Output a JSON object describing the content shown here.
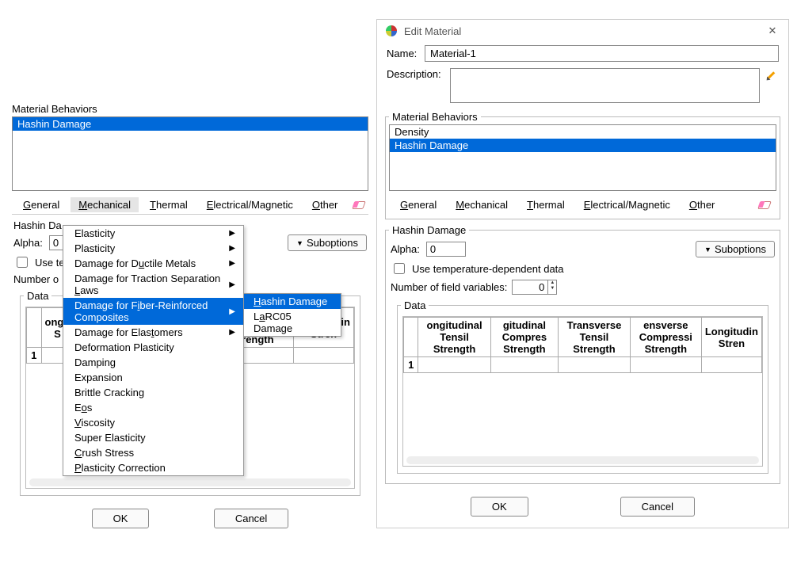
{
  "left": {
    "behaviors_label": "Material Behaviors",
    "behaviors": [
      "Hashin Damage"
    ],
    "selected_behavior": 0,
    "menubar": [
      "General",
      "Mechanical",
      "Thermal",
      "Electrical/Magnetic",
      "Other"
    ],
    "menu_underlines": [
      "G",
      "M",
      "T",
      "E",
      "O"
    ],
    "open_menu": 1,
    "dropdown": [
      {
        "label": "Elasticity",
        "has_sub": true
      },
      {
        "label": "Plasticity",
        "has_sub": true
      },
      {
        "label": "Damage for Ductile Metals",
        "ul": "D",
        "has_sub": true
      },
      {
        "label": "Damage for Traction Separation Laws",
        "ul": "L",
        "has_sub": true
      },
      {
        "label": "Damage for Fiber-Reinforced Composites",
        "ul": "i",
        "has_sub": true,
        "hover": true
      },
      {
        "label": "Damage for Elastomers",
        "ul": "t",
        "has_sub": true
      },
      {
        "label": "Deformation Plasticity"
      },
      {
        "label": "Damping"
      },
      {
        "label": "Expansion"
      },
      {
        "label": "Brittle Cracking"
      },
      {
        "label": "Eos",
        "ul": "o"
      },
      {
        "label": "Viscosity",
        "ul": "V"
      },
      {
        "label": "Super Elasticity"
      },
      {
        "label": "Crush Stress",
        "ul": "C"
      },
      {
        "label": "Plasticity Correction",
        "ul": "P"
      }
    ],
    "submenu": [
      {
        "label": "Hashin Damage",
        "ul": "H",
        "hover": true
      },
      {
        "label": "LaRC05 Damage",
        "ul": "a"
      }
    ],
    "hashin_label": "Hashin Da",
    "alpha_label": "Alpha:",
    "alpha_value": "0",
    "suboptions_label": "Suboptions",
    "use_temp_label": "Use te",
    "numvars_label": "Number o",
    "data_label": "Data",
    "columns_visible": [
      "ongit\nS",
      "ensverse Compressi\nStrength",
      "Longitudin\nStren"
    ],
    "row": "1",
    "ok": "OK",
    "cancel": "Cancel"
  },
  "right": {
    "title": "Edit Material",
    "name_label": "Name:",
    "name_value": "Material-1",
    "desc_label": "Description:",
    "desc_value": "",
    "behaviors_label": "Material Behaviors",
    "behaviors": [
      "Density",
      "Hashin Damage"
    ],
    "selected_behavior": 1,
    "menubar": [
      "General",
      "Mechanical",
      "Thermal",
      "Electrical/Magnetic",
      "Other"
    ],
    "menu_underlines": [
      "G",
      "M",
      "T",
      "E",
      "O"
    ],
    "hashin_label": "Hashin Damage",
    "alpha_label": "Alpha:",
    "alpha_value": "0",
    "suboptions_label": "Suboptions",
    "use_temp_label": "Use temperature-dependent data",
    "numvars_label": "Number of field variables:",
    "numvars_value": "0",
    "data_label": "Data",
    "columns": [
      "ongitudinal Tensil\nStrength",
      "gitudinal Compres\nStrength",
      "Transverse Tensil\nStrength",
      "ensverse Compressi\nStrength",
      "Longitudin\nStren"
    ],
    "row": "1",
    "ok": "OK",
    "cancel": "Cancel"
  }
}
